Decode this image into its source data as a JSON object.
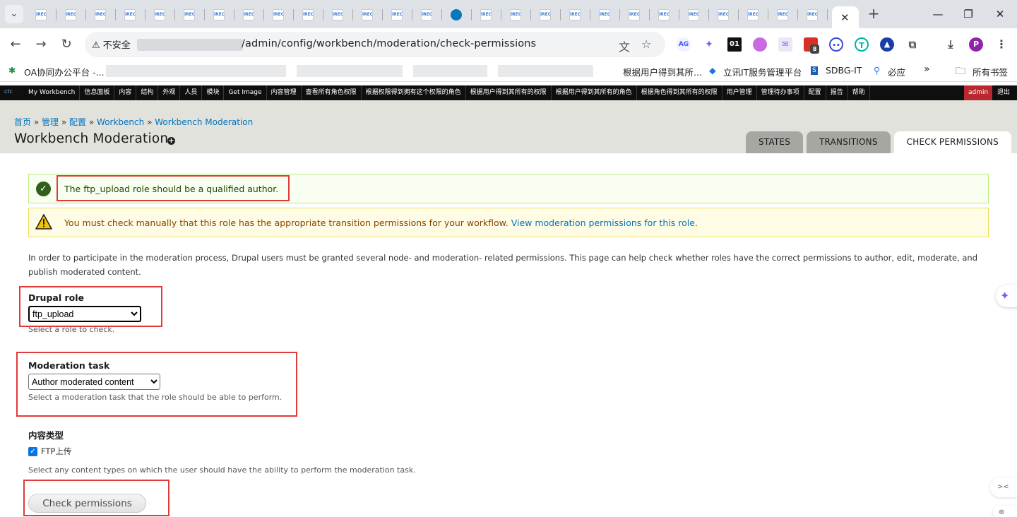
{
  "browser": {
    "address": {
      "security_label": "不安全",
      "url": "/admin/config/workbench/moderation/check-permissions"
    },
    "bookmarks": [
      {
        "label": "OA协同办公平台 -..."
      },
      {
        "label": "根据用户得到其所..."
      },
      {
        "label": "立讯IT服务管理平台"
      },
      {
        "label": "SDBG-IT"
      },
      {
        "label": "必应"
      },
      {
        "label": "所有书签"
      }
    ],
    "tab_favicon_text": "iREC",
    "extensions": [
      {
        "name": "ag-extension-icon",
        "text": "AG"
      },
      {
        "name": "tab-count-badge",
        "text": "8"
      },
      {
        "name": "profile-avatar",
        "text": "P"
      },
      {
        "name": "ext-01-icon",
        "text": "01"
      }
    ]
  },
  "admin_toolbar": {
    "logo": "ctc",
    "items": [
      "My Workbench",
      "信息面板",
      "内容",
      "结构",
      "外观",
      "人员",
      "模块",
      "Get Image",
      "内容管理",
      "查看所有角色权限",
      "根据权限得到拥有这个权限的角色",
      "根据用户得到其所有的权限",
      "根据用户得到其所有的角色",
      "根据角色得到其所有的权限",
      "用户管理",
      "管理待办事项",
      "配置",
      "报告",
      "帮助"
    ],
    "user": "admin",
    "logout": "退出"
  },
  "header": {
    "breadcrumb": [
      "首页",
      "管理",
      "配置",
      "Workbench",
      "Workbench Moderation"
    ],
    "breadcrumb_separator": "»",
    "title": "Workbench Moderation",
    "tabs": [
      {
        "label": "STATES",
        "active": false
      },
      {
        "label": "TRANSITIONS",
        "active": false
      },
      {
        "label": "CHECK PERMISSIONS",
        "active": true
      }
    ]
  },
  "messages": {
    "status": "The ftp_upload role should be a qualified author.",
    "warning": "You must check manually that this role has the appropriate transition permissions for your workflow.",
    "warning_link": "View moderation permissions for this role"
  },
  "intro": "In order to participate in the moderation process, Drupal users must be granted several node- and moderation- related permissions. This page can help check whether roles have the correct permissions to author, edit, moderate, and publish moderated content.",
  "form": {
    "role": {
      "label": "Drupal role",
      "value": "ftp_upload",
      "description": "Select a role to check."
    },
    "task": {
      "label": "Moderation task",
      "value": "Author moderated content",
      "description": "Select a moderation task that the role should be able to perform."
    },
    "content_types": {
      "label": "内容类型",
      "options": [
        {
          "label": "FTP上传",
          "checked": true
        }
      ],
      "description": "Select any content types on which the user should have the ability to perform the moderation task."
    },
    "submit_label": "Check permissions"
  },
  "colors": {
    "annotation_red": "#e23a3a",
    "link_blue": "#0074bd",
    "admin_red": "#b8282e"
  }
}
